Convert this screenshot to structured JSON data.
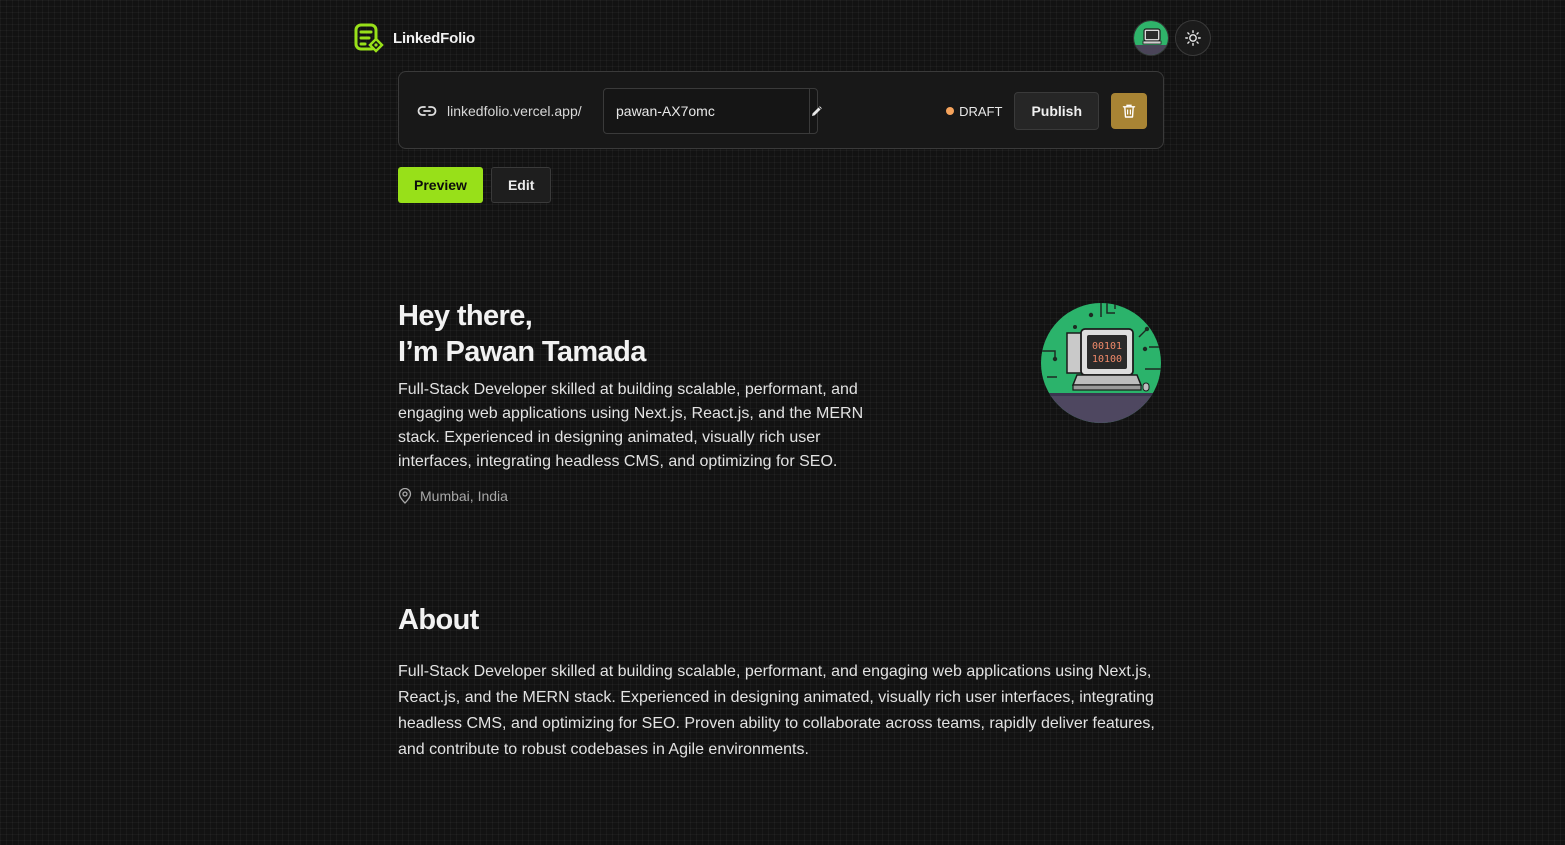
{
  "app": {
    "name": "LinkedFolio"
  },
  "header": {
    "avatar_icon": "user-avatar-computer",
    "theme_icon": "sun-icon"
  },
  "url_bar": {
    "link_icon": "link-icon",
    "prefix": "linkedfolio.vercel.app/",
    "slug_value": "pawan-AX7omc",
    "edit_icon": "pencil-icon",
    "status_text": "DRAFT",
    "status_color": "#f5a35c",
    "publish_label": "Publish",
    "delete_icon": "trash-icon",
    "delete_color": "#a88434"
  },
  "tabs": [
    {
      "label": "Preview",
      "active": true
    },
    {
      "label": "Edit",
      "active": false
    }
  ],
  "hero": {
    "greeting_line1": "Hey there,",
    "greeting_line2": "I’m Pawan Tamada",
    "bio": "Full-Stack Developer skilled at building scalable, performant, and engaging web applications using Next.js, React.js, and the MERN stack. Experienced in designing animated, visually rich user interfaces, integrating headless CMS, and optimizing for SEO.",
    "location_icon": "map-pin-icon",
    "location": "Mumbai, India"
  },
  "about": {
    "title": "About",
    "text": "Full-Stack Developer skilled at building scalable, performant, and engaging web applications using Next.js, React.js, and the MERN stack. Experienced in designing animated, visually rich user interfaces, integrating headless CMS, and optimizing for SEO. Proven ability to collaborate across teams, rapidly deliver features, and contribute to robust codebases in Agile environments."
  },
  "theme": {
    "accent": "#98e019",
    "background": "#121212"
  }
}
